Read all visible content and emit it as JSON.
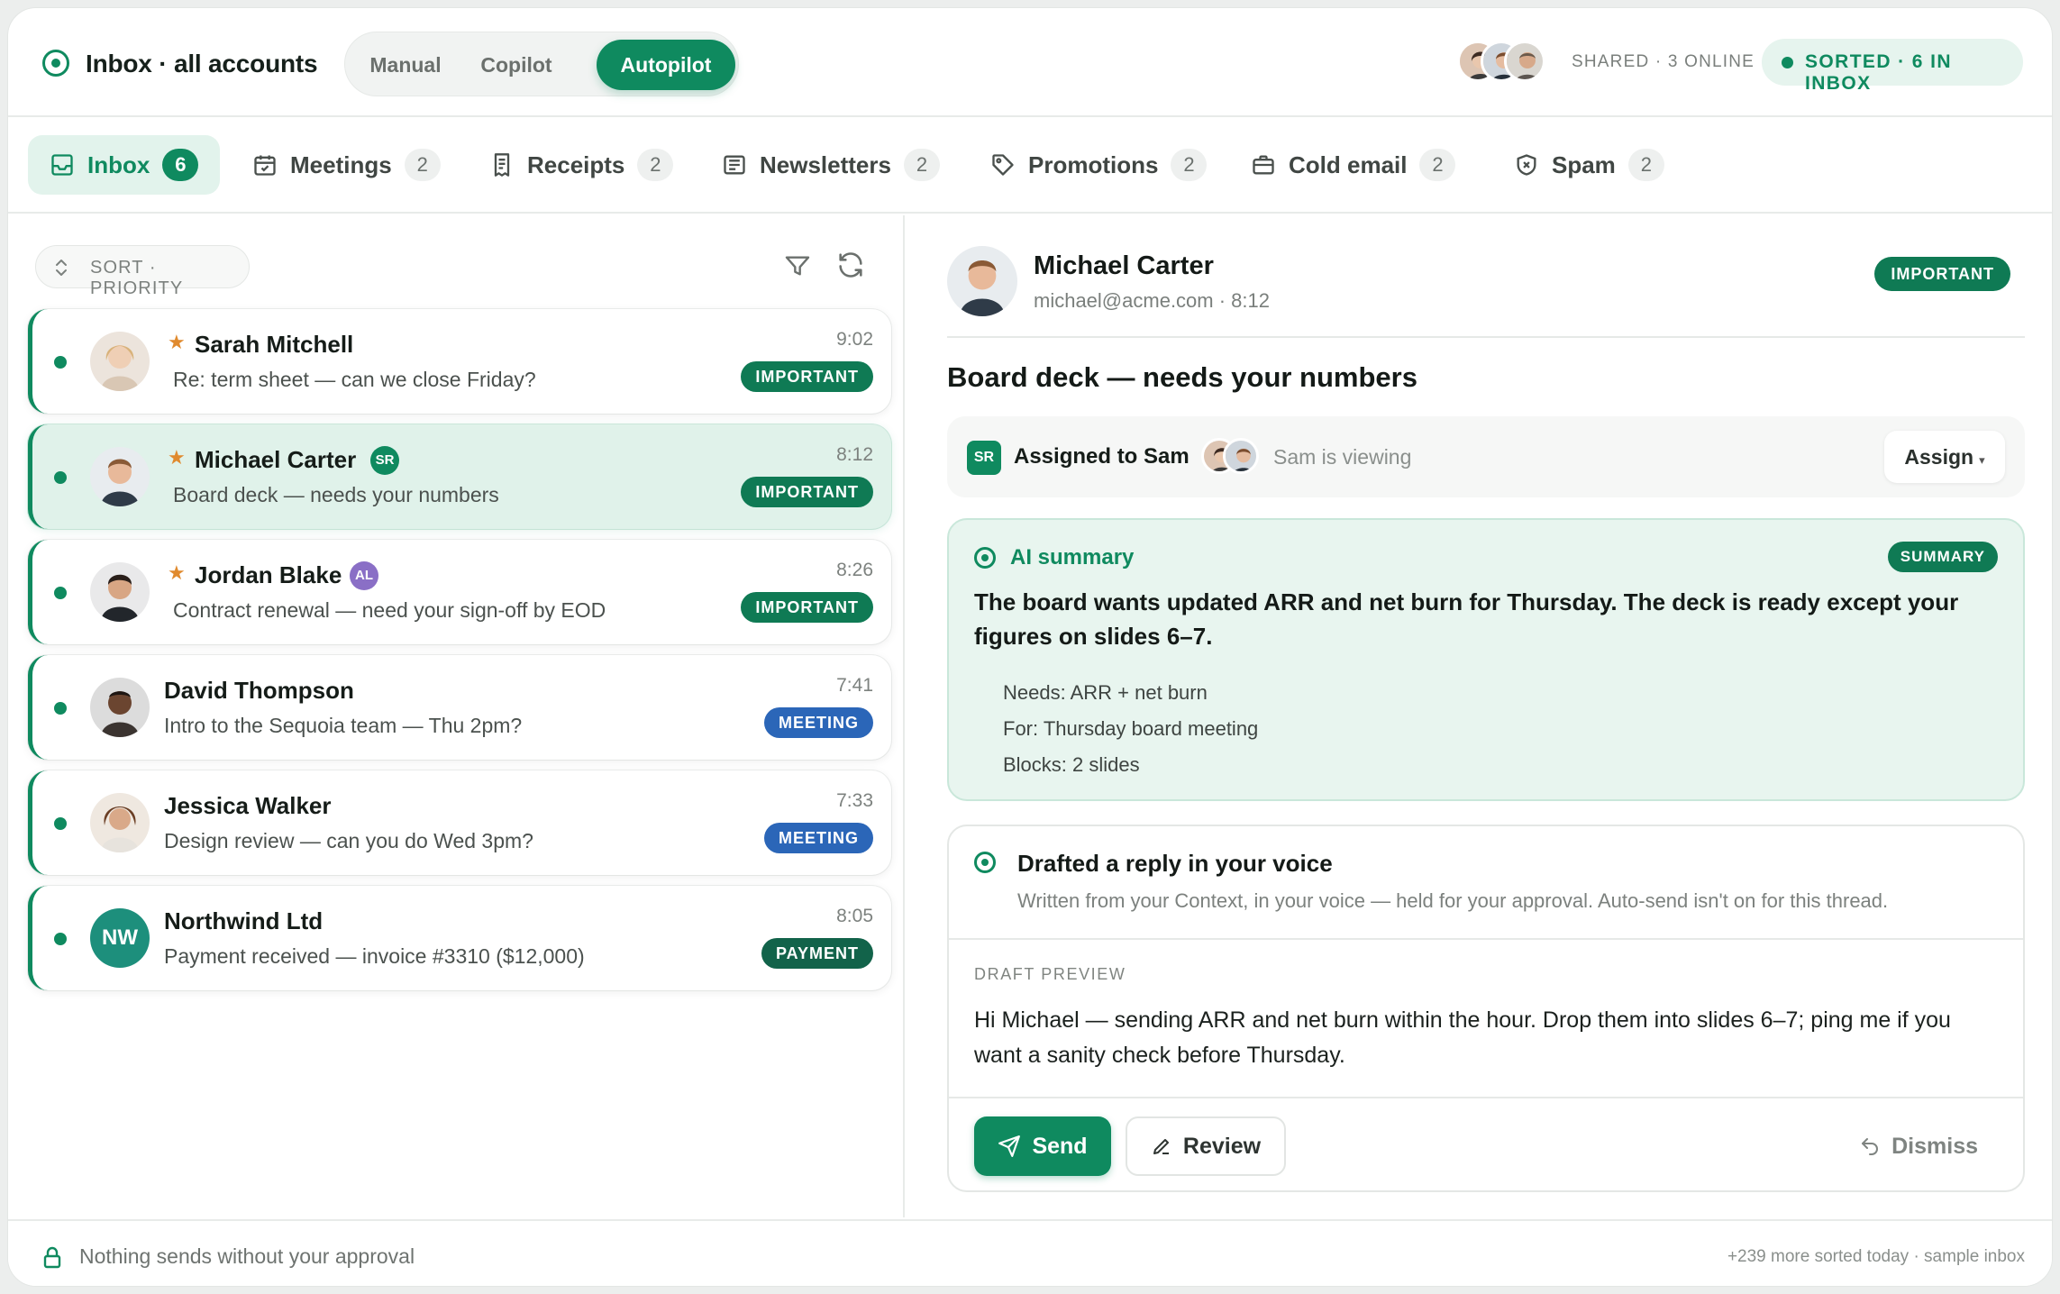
{
  "header": {
    "title": "Inbox · all accounts",
    "modes": [
      "Manual",
      "Copilot",
      "Autopilot"
    ],
    "active_mode": "Autopilot",
    "shared_text": "SHARED · 3 ONLINE",
    "sorted_text": "SORTED · 6 IN INBOX"
  },
  "tabs": [
    {
      "label": "Inbox",
      "count": "6",
      "icon": "inbox-icon"
    },
    {
      "label": "Meetings",
      "count": "2",
      "icon": "calendar-icon"
    },
    {
      "label": "Receipts",
      "count": "2",
      "icon": "receipt-icon"
    },
    {
      "label": "Newsletters",
      "count": "2",
      "icon": "newsletter-icon"
    },
    {
      "label": "Promotions",
      "count": "2",
      "icon": "tag-icon"
    },
    {
      "label": "Cold email",
      "count": "2",
      "icon": "briefcase-icon"
    },
    {
      "label": "Spam",
      "count": "2",
      "icon": "shield-icon"
    }
  ],
  "list": {
    "sort_label": "SORT · PRIORITY",
    "items": [
      {
        "sender": "Sarah Mitchell",
        "starred": true,
        "assignee": "",
        "subject": "Re: term sheet — can we close Friday?",
        "time": "9:02",
        "tag": "IMPORTANT"
      },
      {
        "sender": "Michael Carter",
        "starred": true,
        "assignee": "SR",
        "subject": "Board deck — needs your numbers",
        "time": "8:12",
        "tag": "IMPORTANT"
      },
      {
        "sender": "Jordan Blake",
        "starred": true,
        "assignee": "AL",
        "subject": "Contract renewal — need your sign-off by EOD",
        "time": "8:26",
        "tag": "IMPORTANT"
      },
      {
        "sender": "David Thompson",
        "starred": false,
        "assignee": "",
        "subject": "Intro to the Sequoia team — Thu 2pm?",
        "time": "7:41",
        "tag": "MEETING"
      },
      {
        "sender": "Jessica Walker",
        "starred": false,
        "assignee": "",
        "subject": "Design review — can you do Wed 3pm?",
        "time": "7:33",
        "tag": "MEETING"
      },
      {
        "sender": "Northwind Ltd",
        "starred": false,
        "assignee": "",
        "initials": "NW",
        "subject": "Payment received — invoice #3310 ($12,000)",
        "time": "8:05",
        "tag": "PAYMENT"
      }
    ]
  },
  "detail": {
    "name": "Michael Carter",
    "meta": "michael@acme.com · 8:12",
    "badge": "IMPORTANT",
    "subject": "Board deck — needs your numbers",
    "assign": {
      "initials": "SR",
      "assigned_text": "Assigned to Sam",
      "viewing_text": "Sam is viewing",
      "button": "Assign"
    },
    "summary": {
      "title": "AI summary",
      "badge": "SUMMARY",
      "text": "The board wants updated ARR and net burn for Thursday. The deck is ready except your figures on slides 6–7.",
      "points": [
        "Needs: ARR + net burn",
        "For: Thursday board meeting",
        "Blocks: 2 slides"
      ]
    },
    "draft": {
      "title": "Drafted a reply in your voice",
      "subtitle": "Written from your Context, in your voice — held for your approval. Auto-send isn't on for this thread.",
      "preview_label": "DRAFT PREVIEW",
      "preview_text": "Hi Michael — sending ARR and net burn within the hour. Drop them into slides 6–7; ping me if you want a sanity check before Thursday.",
      "send": "Send",
      "review": "Review",
      "dismiss": "Dismiss"
    }
  },
  "footer": {
    "left": "Nothing sends without your approval",
    "right": "+239 more sorted today · sample inbox"
  },
  "colors": {
    "accent": "#0f8a5f",
    "important": "#0f7a54",
    "meeting": "#2b66b8",
    "payment": "#12634a",
    "selected_row": "#e0f2ea"
  }
}
